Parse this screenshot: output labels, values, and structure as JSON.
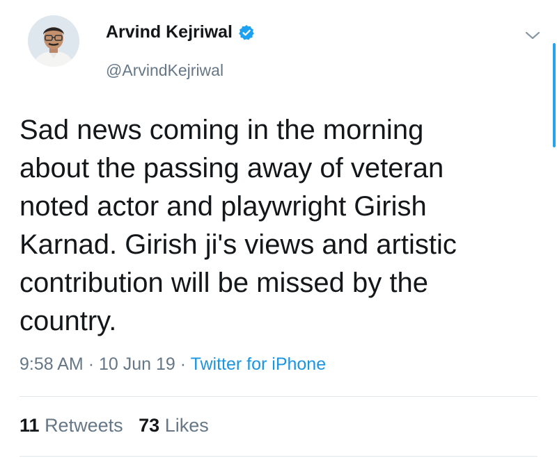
{
  "author": {
    "name": "Arvind Kejriwal",
    "handle": "@ArvindKejriwal",
    "verified": true
  },
  "tweet": {
    "text": "Sad news coming in the morning\nabout the passing away of veteran\nnoted actor and playwright Girish\nKarnad. Girish ji's views and artistic\ncontribution will be missed by the\ncountry.",
    "time": "9:58 AM",
    "separator": "·",
    "date": "10 Jun 19",
    "source": "Twitter for iPhone"
  },
  "stats": {
    "retweets_count": "11",
    "retweets_label": "Retweets",
    "likes_count": "73",
    "likes_label": "Likes"
  },
  "colors": {
    "text": "#14171a",
    "secondary": "#657786",
    "link": "#1b95e0",
    "verified_badge": "#1da1f2",
    "divider": "#e1e8ed"
  },
  "icons": {
    "verified": "verified-badge-icon",
    "menu": "chevron-down-icon"
  }
}
